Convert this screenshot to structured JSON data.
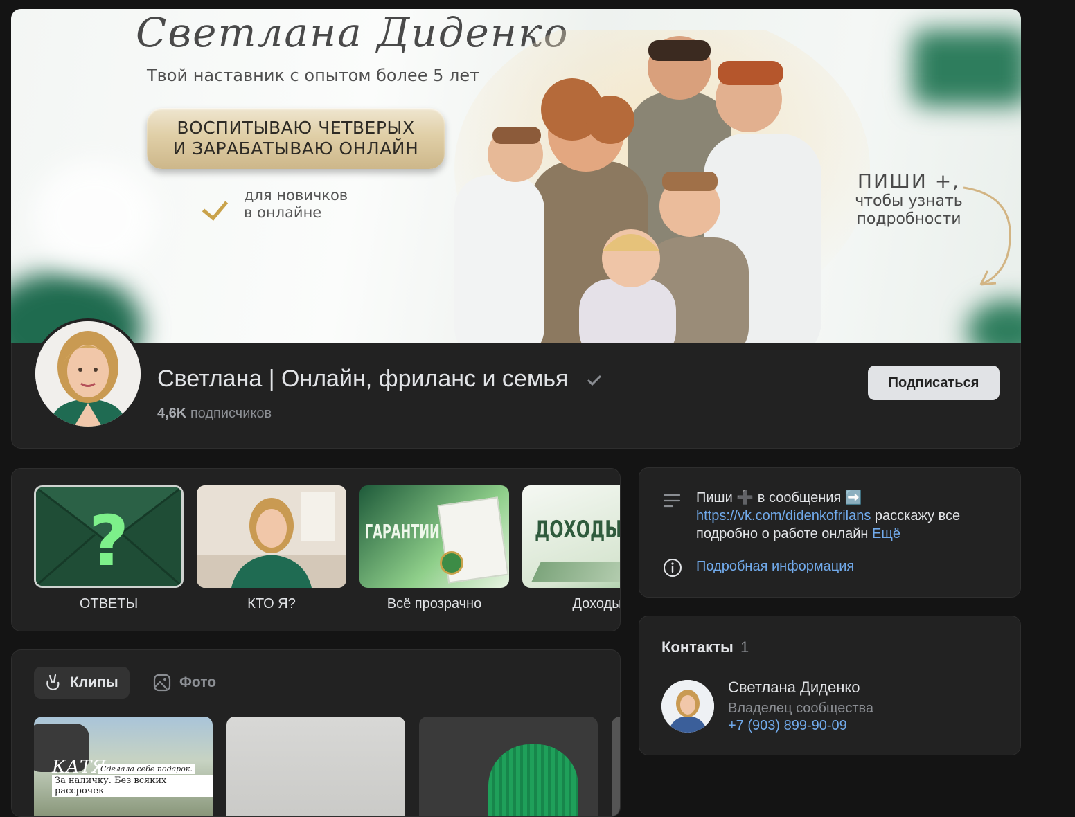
{
  "cover": {
    "title": "Светлана Диденко",
    "subtitle": "Твой наставник с опытом более 5 лет",
    "plaque_line1": "ВОСПИТЫВАЮ ЧЕТВЕРЫХ",
    "plaque_line2": "И ЗАРАБАТЫВАЮ ОНЛАЙН",
    "newbie_line1": "для новичков",
    "newbie_line2": "в онлайне",
    "cta_line1": "ПИШИ +,",
    "cta_line2": "чтобы узнать",
    "cta_line3": "подробности",
    "accent": "#2d6a4f",
    "gold": "#c9a24a"
  },
  "header": {
    "title": "Светлана | Онлайн, фриланс и семья",
    "subs_count": "4,6K",
    "subs_label": "подписчиков",
    "subscribe_label": "Подписаться",
    "verified_icon": "checkmark-icon"
  },
  "stories": [
    {
      "label": "ОТВЕТЫ"
    },
    {
      "label": "КТО Я?"
    },
    {
      "label": "Всё прозрачно",
      "thumb_text": "ГАРАНТИИ"
    },
    {
      "label": "Доходы",
      "thumb_text": "ДОХОДЫ"
    }
  ],
  "clips": {
    "tab_clips": "Клипы",
    "tab_photo": "Фото",
    "clip1_title": "КАТЯ",
    "clip1_caption1": "Сделала себе подарок.",
    "clip1_caption2": "За наличку. Без всяких рассрочек"
  },
  "info": {
    "text_prefix": "Пиши",
    "text_plus": "➕",
    "text_mid": "в сообщения",
    "text_arrow": "➡️",
    "link": "https://vk.com/didenkofrilans",
    "text_rest": "расскажу все подробно о работе онлайн",
    "more": "Ещё",
    "details": "Подробная информация"
  },
  "contacts": {
    "title": "Контакты",
    "count": "1",
    "name": "Светлана Диденко",
    "role": "Владелец сообщества",
    "phone": "+7 (903) 899-90-09"
  },
  "colors": {
    "background": "#141414",
    "card": "#222222",
    "link": "#71aaeb",
    "text": "#e1e3e6",
    "muted": "#8b8e93"
  }
}
